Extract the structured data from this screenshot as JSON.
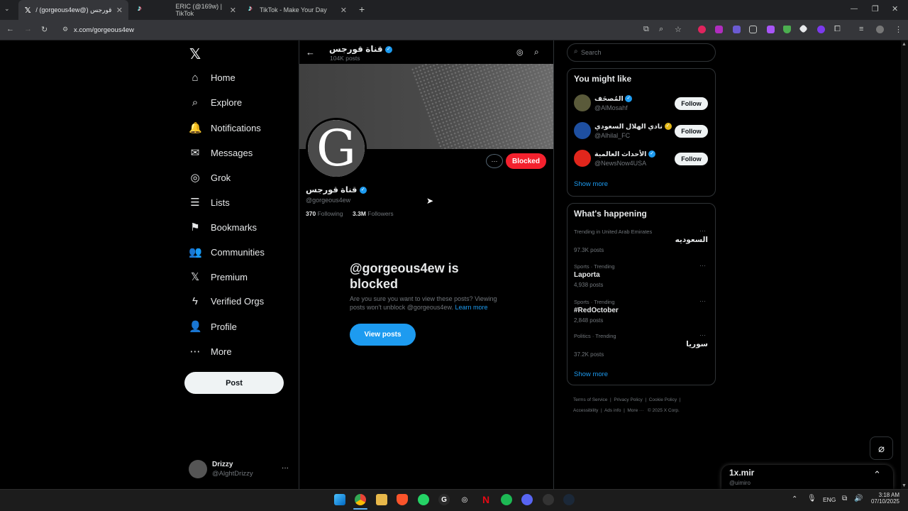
{
  "tabs": [
    {
      "title": "/ (gorgeous4ew@) قناة قورجس",
      "icon": "x-logo-icon"
    },
    {
      "title": "ERIC (@169w) | TikTok",
      "icon": "tiktok-icon"
    },
    {
      "title": "TikTok - Make Your Day",
      "icon": "tiktok-icon"
    }
  ],
  "browser": {
    "url": "x.com/gorgeous4ew",
    "new_tab": "+",
    "minimize": "—",
    "maximize": "❐",
    "close": "✕"
  },
  "nav": {
    "logo": "𝕏",
    "items": [
      {
        "label": "Home",
        "icon": "⌂"
      },
      {
        "label": "Explore",
        "icon": "⌕"
      },
      {
        "label": "Notifications",
        "icon": "🔔"
      },
      {
        "label": "Messages",
        "icon": "✉"
      },
      {
        "label": "Grok",
        "icon": "◎"
      },
      {
        "label": "Lists",
        "icon": "☰"
      },
      {
        "label": "Bookmarks",
        "icon": "⚑"
      },
      {
        "label": "Communities",
        "icon": "👥"
      },
      {
        "label": "Premium",
        "icon": "𝕏"
      },
      {
        "label": "Verified Orgs",
        "icon": "ϟ"
      },
      {
        "label": "Profile",
        "icon": "👤"
      },
      {
        "label": "More",
        "icon": "⋯"
      }
    ],
    "post_button": "Post",
    "account": {
      "name": "Drizzy",
      "handle": "@AlghtDrizzy",
      "more": "···"
    }
  },
  "profile": {
    "header_name": "قناة قورجس",
    "posts_count": "104K posts",
    "avatar_letter": "G",
    "name": "قناة قورجس",
    "handle": "@gorgeous4ew",
    "following_count": "370",
    "following_label": "Following",
    "followers_count": "3.3M",
    "followers_label": "Followers",
    "blocked_button": "Blocked",
    "more_button": "···",
    "blocked_title": "@gorgeous4ew is blocked",
    "blocked_text": "Are you sure you want to view these posts? Viewing posts won't unblock @gorgeous4ew.",
    "learn_more": "Learn more",
    "view_posts": "View posts"
  },
  "search": {
    "placeholder": "Search"
  },
  "might_like": {
    "title": "You might like",
    "users": [
      {
        "name": "المُصحَف",
        "handle": "@AlMosahf",
        "badge": "blue",
        "follow": "Follow"
      },
      {
        "name": "نادي الهلال السعودي",
        "handle": "@Alhilal_FC",
        "badge": "gold",
        "follow": "Follow"
      },
      {
        "name": "الأحداث العالمية",
        "handle": "@NewsNow4USA",
        "badge": "blue",
        "follow": "Follow"
      }
    ],
    "show_more": "Show more"
  },
  "happening": {
    "title": "What's happening",
    "trends": [
      {
        "context": "Trending in United Arab Emirates",
        "topic": "السعوديه",
        "posts": "97.3K posts",
        "rtl": true
      },
      {
        "context": "Sports · Trending",
        "topic": "Laporta",
        "posts": "4,938 posts",
        "rtl": false
      },
      {
        "context": "Sports · Trending",
        "topic": "#RedOctober",
        "posts": "2,848 posts",
        "rtl": false
      },
      {
        "context": "Politics · Trending",
        "topic": "سوريا",
        "posts": "37.2K posts",
        "rtl": true
      }
    ],
    "show_more": "Show more"
  },
  "footer": {
    "links": [
      "Terms of Service",
      "Privacy Policy",
      "Cookie Policy",
      "Accessibility",
      "Ads info",
      "More ···"
    ],
    "copyright": "© 2025 X Corp."
  },
  "messages_drawer": {
    "title": "1x.mir",
    "handle": "@uimiro"
  },
  "taskbar": {
    "lang": "ENG",
    "time": "3:18 AM",
    "date": "07/10/2025"
  }
}
